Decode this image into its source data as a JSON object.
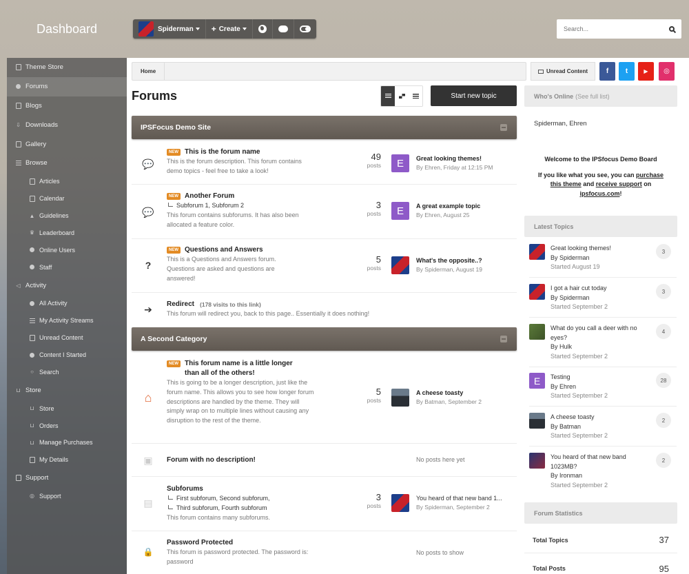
{
  "header": {
    "title": "Dashboard",
    "user_name": "Spiderman",
    "create_label": "Create",
    "search_placeholder": "Search..."
  },
  "sidebar": {
    "items": [
      {
        "label": "Theme Store",
        "icon": "document-icon"
      },
      {
        "label": "Forums",
        "icon": "chat-icon",
        "active": true
      },
      {
        "label": "Blogs",
        "icon": "blog-icon"
      },
      {
        "label": "Downloads",
        "icon": "download-icon"
      },
      {
        "label": "Gallery",
        "icon": "camera-icon"
      },
      {
        "label": "Browse",
        "icon": "list-icon"
      }
    ],
    "browse_items": [
      "Articles",
      "Calendar",
      "Guidelines",
      "Leaderboard",
      "Online Users",
      "Staff"
    ],
    "activity_label": "Activity",
    "activity_items": [
      "All Activity",
      "My Activity Streams",
      "Unread Content",
      "Content I Started",
      "Search"
    ],
    "store_label": "Store",
    "store_items": [
      "Store",
      "Orders",
      "Manage Purchases",
      "My Details"
    ],
    "support_label": "Support",
    "support_items": [
      "Support"
    ]
  },
  "breadcrumb": {
    "home": "Home",
    "unread": "Unread Content"
  },
  "social": {
    "facebook": "f",
    "twitter": "t",
    "youtube": "▶",
    "instagram": "◎"
  },
  "page": {
    "title": "Forums",
    "start_topic": "Start new topic"
  },
  "categories": [
    {
      "name": "IPSFocus Demo Site"
    },
    {
      "name": "A Second Category"
    }
  ],
  "forums": [
    {
      "name": "This is the forum name",
      "new": "NEW",
      "desc": "This is the forum description. This forum contains demo topics - feel free to take a look!",
      "posts": "49",
      "posts_label": "posts",
      "last_title": "Great looking themes!",
      "last_by": "By Ehren, Friday at 12:15 PM",
      "avatar_letter": "E"
    },
    {
      "name": "Another Forum",
      "new": "NEW",
      "subforums": "Subforum 1,  Subforum 2",
      "desc": "This forum contains subforums. It has also been allocated a feature color.",
      "posts": "3",
      "posts_label": "posts",
      "last_title": "A great example topic",
      "last_by": "By Ehren, August 25",
      "avatar_letter": "E"
    },
    {
      "name": "Questions and Answers",
      "new": "NEW",
      "desc": "This is a Questions and Answers forum. Questions are asked and questions are answered!",
      "posts": "5",
      "posts_label": "posts",
      "last_title": "What's the opposite..?",
      "last_by": "By Spiderman, August 19"
    },
    {
      "name": "Redirect",
      "visits": "(178 visits to this link)",
      "desc": "This forum will redirect you, back to this page.. Essentially it does nothing!"
    },
    {
      "name": "This forum name is a little longer than all of the others!",
      "new": "NEW",
      "desc": "This is going to be a longer description, just like the forum name. This allows you to see how longer forum descriptions are handled by the theme. They will simply wrap on to multiple lines without causing any disruption to the rest of the theme.",
      "posts": "5",
      "posts_label": "posts",
      "last_title": "A cheese toasty",
      "last_by": "By Batman, September 2"
    },
    {
      "name": "Forum with no description!",
      "no_posts": "No posts here yet"
    },
    {
      "name": "Subforums",
      "subforums": "First subforum,  Second subforum,",
      "subforums2": "Third subforum,  Fourth subforum",
      "desc": "This forum contains many subforums.",
      "posts": "3",
      "posts_label": "posts",
      "last_title": "You heard of that new band 1...",
      "last_by": "By Spiderman, September 2"
    },
    {
      "name": "Password Protected",
      "desc": "This forum is password protected. The password is: password",
      "no_posts": "No posts to show"
    }
  ],
  "whos_online": {
    "title": "Who's Online",
    "sub": "(See full list)",
    "names": "Spiderman, Ehren"
  },
  "welcome": {
    "line1": "Welcome to the IPSfocus Demo Board",
    "p2a": "If you like what you see, you can ",
    "purchase": "purchase this theme",
    "and": " and ",
    "support": "receive support",
    "on": " on ",
    "site": "ipsfocus.com",
    "bang": "!"
  },
  "latest_topics": {
    "title": "Latest Topics",
    "items": [
      {
        "title": "Great looking themes!",
        "by": "By Spiderman",
        "started": "Started August 19",
        "count": "3"
      },
      {
        "title": "I got a hair cut today",
        "by": "By Spiderman",
        "started": "Started September 2",
        "count": "3"
      },
      {
        "title": "What do you call a deer with no eyes?",
        "by": "By Hulk",
        "started": "Started September 2",
        "count": "4"
      },
      {
        "title": "Testing",
        "by": "By Ehren",
        "started": "Started September 2",
        "count": "28",
        "letter": "E"
      },
      {
        "title": "A cheese toasty",
        "by": "By Batman",
        "started": "Started September 2",
        "count": "2"
      },
      {
        "title": "You heard of that new band 1023MB?",
        "by": "By Ironman",
        "started": "Started September 2",
        "count": "2"
      }
    ]
  },
  "forum_stats": {
    "title": "Forum Statistics",
    "rows": [
      {
        "label": "Total Topics",
        "value": "37"
      },
      {
        "label": "Total Posts",
        "value": "95"
      }
    ]
  }
}
